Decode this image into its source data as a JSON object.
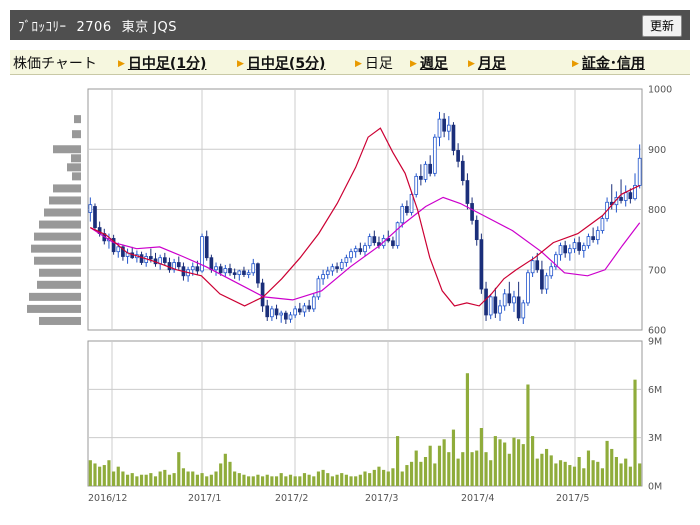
{
  "header": {
    "stock_name": "ﾌﾞﾛｯｺﾘｰ",
    "code": "2706",
    "market": "東京 JQS",
    "refresh_label": "更新"
  },
  "tabs": [
    {
      "label": "株価チャート",
      "type": "title"
    },
    {
      "label": "日中足(1分)",
      "type": "link"
    },
    {
      "label": "日中足(5分)",
      "type": "link"
    },
    {
      "label": "日足",
      "type": "plain"
    },
    {
      "label": "週足",
      "type": "link"
    },
    {
      "label": "月足",
      "type": "link"
    },
    {
      "label": "証金･信用",
      "type": "link"
    }
  ],
  "colors": {
    "up": "#2255cc",
    "down": "#1b2f7a",
    "ma_short": "#cc0033",
    "ma_long": "#cc00cc",
    "volume": "#8fac3b",
    "histogram": "#999999",
    "grid": "#cccccc"
  },
  "chart_data": [
    {
      "type": "candlestick",
      "x_ticks": [
        "2016/12",
        "2017/1",
        "2017/2",
        "2017/3",
        "2017/4",
        "2017/5"
      ],
      "y_ticks": [
        1000,
        900,
        800,
        700,
        600
      ],
      "ylim": [
        600,
        1000
      ],
      "candles": [
        [
          795,
          820,
          780,
          808
        ],
        [
          805,
          810,
          765,
          770
        ],
        [
          770,
          780,
          755,
          760
        ],
        [
          760,
          768,
          742,
          748
        ],
        [
          748,
          760,
          735,
          752
        ],
        [
          752,
          758,
          725,
          730
        ],
        [
          730,
          745,
          720,
          738
        ],
        [
          738,
          742,
          715,
          722
        ],
        [
          722,
          735,
          710,
          728
        ],
        [
          728,
          738,
          718,
          720
        ],
        [
          720,
          732,
          712,
          725
        ],
        [
          725,
          730,
          708,
          712
        ],
        [
          712,
          728,
          705,
          722
        ],
        [
          722,
          735,
          712,
          718
        ],
        [
          718,
          728,
          705,
          710
        ],
        [
          710,
          725,
          700,
          720
        ],
        [
          720,
          728,
          708,
          712
        ],
        [
          712,
          720,
          695,
          700
        ],
        [
          700,
          718,
          695,
          712
        ],
        [
          712,
          722,
          700,
          705
        ],
        [
          705,
          712,
          682,
          690
        ],
        [
          690,
          705,
          680,
          700
        ],
        [
          700,
          712,
          690,
          705
        ],
        [
          705,
          715,
          692,
          698
        ],
        [
          698,
          760,
          695,
          755
        ],
        [
          755,
          765,
          715,
          720
        ],
        [
          720,
          725,
          695,
          700
        ],
        [
          700,
          712,
          690,
          705
        ],
        [
          705,
          710,
          690,
          695
        ],
        [
          695,
          708,
          688,
          702
        ],
        [
          702,
          710,
          690,
          695
        ],
        [
          695,
          702,
          685,
          692
        ],
        [
          692,
          700,
          682,
          698
        ],
        [
          698,
          705,
          688,
          692
        ],
        [
          692,
          700,
          686,
          695
        ],
        [
          695,
          718,
          690,
          710
        ],
        [
          710,
          712,
          670,
          678
        ],
        [
          678,
          685,
          630,
          640
        ],
        [
          640,
          650,
          615,
          622
        ],
        [
          622,
          640,
          615,
          635
        ],
        [
          635,
          642,
          618,
          625
        ],
        [
          625,
          632,
          612,
          628
        ],
        [
          628,
          632,
          610,
          618
        ],
        [
          618,
          630,
          612,
          625
        ],
        [
          625,
          640,
          620,
          635
        ],
        [
          635,
          645,
          625,
          630
        ],
        [
          630,
          645,
          622,
          640
        ],
        [
          640,
          650,
          630,
          635
        ],
        [
          635,
          660,
          630,
          655
        ],
        [
          655,
          690,
          650,
          685
        ],
        [
          685,
          700,
          675,
          692
        ],
        [
          692,
          705,
          685,
          698
        ],
        [
          698,
          710,
          690,
          705
        ],
        [
          705,
          712,
          695,
          702
        ],
        [
          702,
          718,
          698,
          712
        ],
        [
          712,
          725,
          705,
          720
        ],
        [
          720,
          735,
          712,
          730
        ],
        [
          730,
          740,
          720,
          735
        ],
        [
          735,
          745,
          725,
          730
        ],
        [
          730,
          745,
          722,
          740
        ],
        [
          740,
          760,
          735,
          755
        ],
        [
          755,
          765,
          740,
          745
        ],
        [
          745,
          755,
          735,
          740
        ],
        [
          740,
          758,
          735,
          752
        ],
        [
          752,
          765,
          745,
          748
        ],
        [
          748,
          755,
          735,
          740
        ],
        [
          740,
          780,
          735,
          778
        ],
        [
          778,
          810,
          770,
          805
        ],
        [
          805,
          815,
          790,
          795
        ],
        [
          795,
          830,
          790,
          825
        ],
        [
          825,
          860,
          820,
          855
        ],
        [
          855,
          875,
          840,
          850
        ],
        [
          850,
          880,
          845,
          875
        ],
        [
          875,
          890,
          855,
          860
        ],
        [
          860,
          925,
          855,
          920
        ],
        [
          920,
          962,
          905,
          950
        ],
        [
          950,
          960,
          920,
          930
        ],
        [
          930,
          955,
          915,
          940
        ],
        [
          940,
          945,
          890,
          898
        ],
        [
          898,
          910,
          870,
          880
        ],
        [
          880,
          890,
          840,
          848
        ],
        [
          848,
          860,
          800,
          810
        ],
        [
          810,
          820,
          775,
          782
        ],
        [
          782,
          790,
          740,
          750
        ],
        [
          750,
          760,
          660,
          668
        ],
        [
          668,
          680,
          615,
          625
        ],
        [
          625,
          660,
          618,
          655
        ],
        [
          655,
          670,
          620,
          628
        ],
        [
          628,
          650,
          615,
          640
        ],
        [
          640,
          668,
          632,
          660
        ],
        [
          660,
          680,
          640,
          645
        ],
        [
          645,
          665,
          630,
          655
        ],
        [
          655,
          680,
          615,
          620
        ],
        [
          620,
          650,
          610,
          645
        ],
        [
          645,
          700,
          640,
          695
        ],
        [
          695,
          722,
          688,
          715
        ],
        [
          715,
          728,
          695,
          700
        ],
        [
          700,
          715,
          660,
          668
        ],
        [
          668,
          695,
          660,
          690
        ],
        [
          690,
          712,
          685,
          705
        ],
        [
          705,
          730,
          700,
          725
        ],
        [
          725,
          745,
          715,
          740
        ],
        [
          740,
          748,
          720,
          728
        ],
        [
          728,
          742,
          715,
          735
        ],
        [
          735,
          752,
          728,
          745
        ],
        [
          745,
          755,
          725,
          732
        ],
        [
          732,
          745,
          720,
          740
        ],
        [
          740,
          760,
          735,
          755
        ],
        [
          755,
          770,
          745,
          750
        ],
        [
          750,
          772,
          742,
          765
        ],
        [
          765,
          790,
          760,
          785
        ],
        [
          785,
          820,
          780,
          812
        ],
        [
          812,
          842,
          800,
          808
        ],
        [
          808,
          830,
          795,
          820
        ],
        [
          820,
          850,
          810,
          815
        ],
        [
          815,
          840,
          805,
          828
        ],
        [
          828,
          835,
          810,
          818
        ],
        [
          818,
          860,
          815,
          840
        ],
        [
          840,
          908,
          835,
          885
        ]
      ],
      "ma_short": [
        [
          0,
          770
        ],
        [
          5,
          758
        ],
        [
          12,
          728
        ],
        [
          20,
          715
        ],
        [
          28,
          700
        ],
        [
          36,
          690
        ],
        [
          42,
          660
        ],
        [
          50,
          640
        ],
        [
          56,
          655
        ],
        [
          62,
          685
        ],
        [
          68,
          720
        ],
        [
          74,
          760
        ],
        [
          80,
          810
        ],
        [
          86,
          870
        ],
        [
          90,
          920
        ],
        [
          94,
          935
        ],
        [
          98,
          895
        ],
        [
          102,
          860
        ],
        [
          106,
          800
        ],
        [
          110,
          720
        ],
        [
          114,
          665
        ],
        [
          118,
          640
        ],
        [
          122,
          645
        ],
        [
          126,
          640
        ],
        [
          130,
          660
        ],
        [
          134,
          685
        ],
        [
          138,
          700
        ],
        [
          144,
          720
        ],
        [
          150,
          745
        ],
        [
          158,
          760
        ],
        [
          166,
          790
        ],
        [
          172,
          825
        ],
        [
          178,
          840
        ]
      ],
      "ma_long": [
        [
          0,
          770
        ],
        [
          8,
          745
        ],
        [
          16,
          735
        ],
        [
          24,
          738
        ],
        [
          32,
          722
        ],
        [
          40,
          705
        ],
        [
          50,
          680
        ],
        [
          60,
          655
        ],
        [
          70,
          650
        ],
        [
          80,
          665
        ],
        [
          90,
          705
        ],
        [
          100,
          740
        ],
        [
          108,
          775
        ],
        [
          116,
          805
        ],
        [
          122,
          820
        ],
        [
          128,
          810
        ],
        [
          136,
          790
        ],
        [
          146,
          765
        ],
        [
          156,
          730
        ],
        [
          164,
          695
        ],
        [
          172,
          690
        ],
        [
          178,
          700
        ],
        [
          184,
          740
        ],
        [
          190,
          778
        ]
      ],
      "price_histogram": [
        [
          950,
          7
        ],
        [
          925,
          9
        ],
        [
          900,
          28
        ],
        [
          885,
          10
        ],
        [
          870,
          14
        ],
        [
          855,
          9
        ],
        [
          835,
          28
        ],
        [
          815,
          32
        ],
        [
          795,
          37
        ],
        [
          775,
          42
        ],
        [
          755,
          47
        ],
        [
          735,
          50
        ],
        [
          715,
          47
        ],
        [
          695,
          42
        ],
        [
          675,
          44
        ],
        [
          655,
          52
        ],
        [
          635,
          54
        ],
        [
          615,
          42
        ]
      ]
    },
    {
      "type": "bar",
      "title": "",
      "y_ticks": [
        "9M",
        "6M",
        "3M",
        "0M"
      ],
      "ylim": [
        0,
        9
      ],
      "values": [
        1.6,
        1.4,
        1.2,
        1.3,
        1.6,
        0.9,
        1.2,
        0.9,
        0.7,
        0.8,
        0.6,
        0.7,
        0.7,
        0.8,
        0.6,
        0.9,
        1.0,
        0.7,
        0.8,
        2.1,
        1.1,
        0.9,
        0.9,
        0.7,
        0.8,
        0.6,
        0.7,
        0.9,
        1.4,
        2.0,
        1.5,
        0.9,
        0.8,
        0.7,
        0.6,
        0.6,
        0.7,
        0.6,
        0.7,
        0.6,
        0.6,
        0.8,
        0.6,
        0.7,
        0.6,
        0.6,
        0.8,
        0.7,
        0.6,
        0.9,
        1.0,
        0.8,
        0.6,
        0.7,
        0.8,
        0.7,
        0.6,
        0.6,
        0.7,
        0.9,
        0.8,
        1.0,
        1.2,
        1.0,
        0.9,
        1.1,
        3.1,
        0.9,
        1.3,
        1.5,
        2.2,
        1.5,
        1.8,
        2.5,
        1.4,
        2.5,
        2.9,
        2.1,
        3.5,
        1.7,
        2.1,
        7.0,
        2.1,
        2.2,
        3.6,
        2.1,
        1.6,
        3.1,
        2.9,
        2.7,
        2.0,
        3.0,
        2.9,
        2.6,
        6.3,
        3.1,
        1.7,
        2.0,
        2.3,
        1.9,
        1.4,
        1.6,
        1.5,
        1.3,
        1.2,
        1.8,
        1.1,
        2.2,
        1.6,
        1.5,
        1.1,
        2.8,
        2.3,
        1.8,
        1.4,
        1.7,
        1.2,
        6.6,
        1.4
      ]
    }
  ]
}
